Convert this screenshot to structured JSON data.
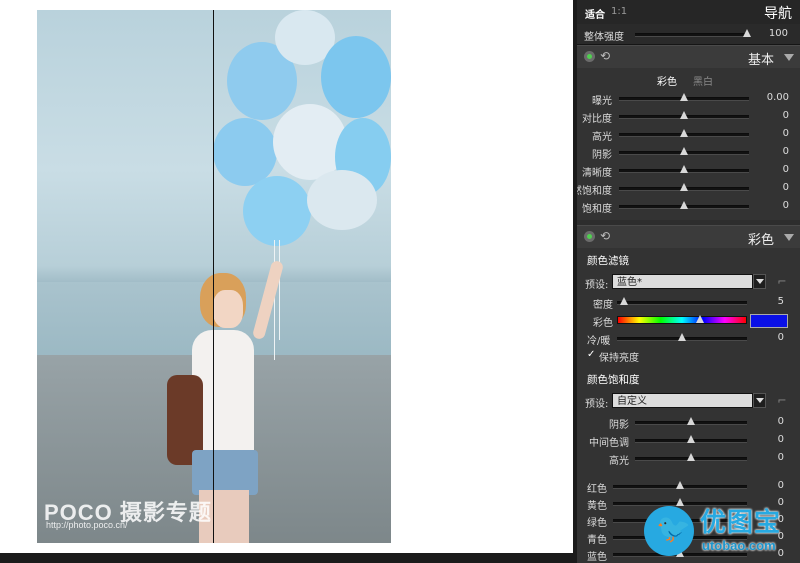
{
  "watermark": {
    "brand": "POCO 摄影专题",
    "url": "http://photo.poco.cn/"
  },
  "nav": {
    "fit": "适合",
    "ratio": "1:1",
    "title": "导航"
  },
  "intensity": {
    "label": "整体强度",
    "value": "100",
    "level": 1.0
  },
  "basic": {
    "title": "基本",
    "tab_color": "彩色",
    "tab_bw": "黑白",
    "sliders": [
      {
        "label": "曝光",
        "value": "0.00",
        "level": 0.5
      },
      {
        "label": "对比度",
        "value": "0",
        "level": 0.5
      },
      {
        "label": "高光",
        "value": "0",
        "level": 0.5
      },
      {
        "label": "阴影",
        "value": "0",
        "level": 0.5
      },
      {
        "label": "清晰度",
        "value": "0",
        "level": 0.5
      },
      {
        "label": "自然饱和度",
        "value": "0",
        "level": 0.5
      },
      {
        "label": "饱和度",
        "value": "0",
        "level": 0.5
      }
    ]
  },
  "color": {
    "title": "彩色",
    "filter": {
      "heading": "颜色滤镜",
      "preset_label": "预设:",
      "preset_value": "蓝色*",
      "density_label": "密度",
      "density_value": "5",
      "density_level": 0.05,
      "hue_label": "彩色",
      "hue_level": 0.65,
      "swatch_color": "#0a10e6",
      "warm_label": "冷/暖",
      "warm_value": "0",
      "warm_level": 0.5,
      "keep_label": "保持亮度"
    },
    "saturation": {
      "heading": "颜色饱和度",
      "preset_label": "预设:",
      "preset_value": "自定义",
      "tones": [
        {
          "label": "阴影",
          "value": "0",
          "level": 0.5
        },
        {
          "label": "中间色调",
          "value": "0",
          "level": 0.5
        },
        {
          "label": "高光",
          "value": "0",
          "level": 0.5
        }
      ],
      "colors": [
        {
          "label": "红色",
          "value": "0",
          "level": 0.5
        },
        {
          "label": "黄色",
          "value": "0",
          "level": 0.5
        },
        {
          "label": "绿色",
          "value": "0",
          "level": 0.5
        },
        {
          "label": "青色",
          "value": "0",
          "level": 0.5
        },
        {
          "label": "蓝色",
          "value": "0",
          "level": 0.5
        }
      ]
    }
  },
  "logo": {
    "cn": "优图宝",
    "url": "utobao.com"
  }
}
